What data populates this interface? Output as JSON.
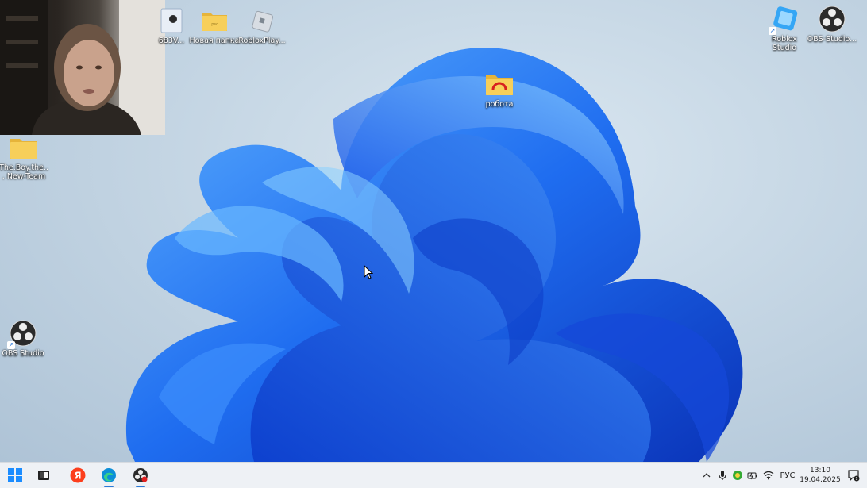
{
  "desktop_icons": [
    {
      "id": "partial-file",
      "label": "683V..."
    },
    {
      "id": "new-folder",
      "label": "Новая папка"
    },
    {
      "id": "roblox-player",
      "label": "RobloxPlay..."
    },
    {
      "id": "roblox-studio",
      "label": "Roblox Studio"
    },
    {
      "id": "obs-studio-top",
      "label": "OBS-Studio..."
    },
    {
      "id": "robota-folder",
      "label": "робота"
    },
    {
      "id": "the-boy-folder",
      "label": "The.Boy.the... New-Team"
    },
    {
      "id": "obs-studio",
      "label": "OBS Studio"
    }
  ],
  "taskbar": {
    "apps": [
      "start",
      "file-explorer",
      "yandex-browser",
      "edge-browser",
      "obs-app"
    ],
    "tray": {
      "language": "РУС",
      "time": "13:10",
      "date": "19.04.2025"
    }
  },
  "colors": {
    "accent": "#2c7ad6",
    "folder": "#f4c542",
    "bloom_light": "#4aa0ff",
    "bloom_dark": "#0f3fc4"
  }
}
